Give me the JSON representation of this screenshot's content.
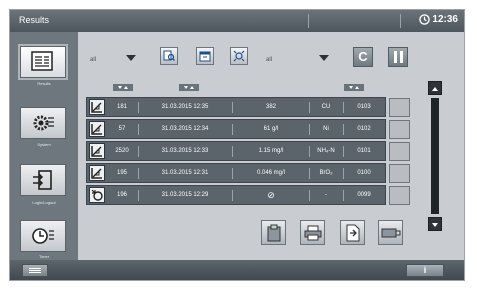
{
  "window": {
    "title": "Results",
    "time": "12:36"
  },
  "nav": [
    {
      "label": "Results",
      "icon": "results-icon"
    },
    {
      "label": "System",
      "icon": "system-gear-icon"
    },
    {
      "label": "Login/Logout",
      "icon": "login-logout-icon"
    },
    {
      "label": "Timer",
      "icon": "timer-icon"
    }
  ],
  "toolbar": {
    "filter1_value": "all",
    "filter2_value": "all",
    "clear_label": "C",
    "icons": [
      "search-document-icon",
      "calendar-icon",
      "target-icon",
      "pause-icon"
    ]
  },
  "table": {
    "rows": [
      {
        "type_icon": "calibration-curve-icon",
        "id": "181",
        "datetime": "31.03.2015 12:35",
        "value": "382",
        "param": "CU",
        "code": "0103"
      },
      {
        "type_icon": "calibration-curve-icon",
        "id": "57",
        "datetime": "31.03.2015 12:34",
        "value": "61 g/l",
        "param": "Ni",
        "code": "0102"
      },
      {
        "type_icon": "calibration-curve-icon",
        "id": "2520",
        "datetime": "31.03.2015 12:33",
        "value": "1.15 mg/l",
        "param": "NH₄-N",
        "code": "0101"
      },
      {
        "type_icon": "calibration-curve-icon",
        "id": "195",
        "datetime": "31.03.2015 12:31",
        "value": "0.046 mg/l",
        "param": "BrO₃",
        "code": "0100"
      },
      {
        "type_icon": "sample-info-icon",
        "id": "196",
        "datetime": "31.03.2015 12:29",
        "value": "⊘",
        "param": "-",
        "code": "0099"
      }
    ]
  },
  "actions": [
    "clipboard-icon",
    "printer-icon",
    "export-document-icon",
    "usb-stick-icon"
  ],
  "footer": {
    "info_label": "i"
  },
  "colors": {
    "titlebar": "#5b636b",
    "row": "#5b636b",
    "panel": "#c9ccd0"
  }
}
